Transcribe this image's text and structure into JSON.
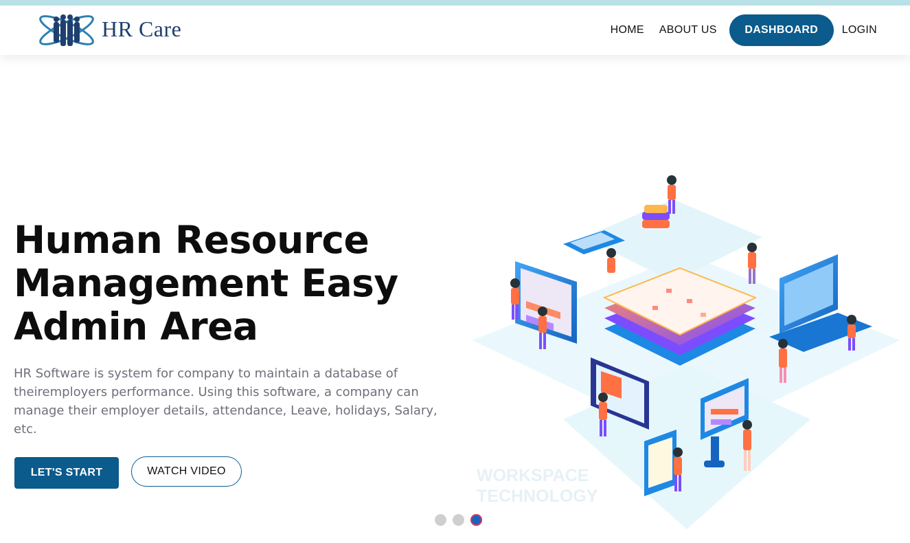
{
  "brand": {
    "name": "HR Care"
  },
  "nav": {
    "home": "HOME",
    "about": "ABOUT US",
    "dashboard": "DASHBOARD",
    "login": "LOGIN"
  },
  "hero": {
    "title": "Human Resource Management Easy Admin Area",
    "description": "HR Software is system for company to maintain a database of theiremployers performance. Using this software, a company can manage their employer details, attendance, Leave, holidays, Salary, etc.",
    "primary_button": "LET'S START",
    "secondary_button": "WATCH VIDEO",
    "watermark_line1": "WORKSPACE",
    "watermark_line2": "TECHNOLOGY"
  },
  "carousel": {
    "total_slides": 3,
    "active_slide": 3
  },
  "colors": {
    "brand_blue": "#0b5b8c",
    "top_strip": "#b9e2e8",
    "active_dot": "#1565c0"
  },
  "icons": {
    "logo": "people-globe-logo-icon"
  }
}
